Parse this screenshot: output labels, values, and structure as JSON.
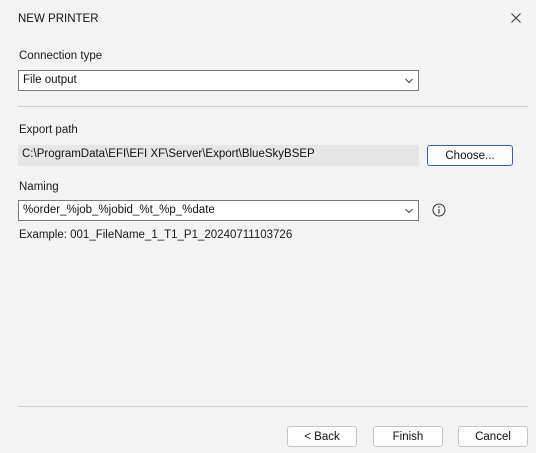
{
  "window": {
    "title": "NEW PRINTER"
  },
  "connection": {
    "label": "Connection type",
    "selected": "File output"
  },
  "export": {
    "label": "Export path",
    "path": "C:\\ProgramData\\EFI\\EFI XF\\Server\\Export\\BlueSkyBSEP",
    "choose_label": "Choose..."
  },
  "naming": {
    "label": "Naming",
    "selected": "%order_%job_%jobid_%t_%p_%date",
    "example": "Example: 001_FileName_1_T1_P1_20240711103726"
  },
  "footer": {
    "back_label": "< Back",
    "finish_label": "Finish",
    "cancel_label": "Cancel"
  },
  "icons": {
    "close": "close-icon",
    "chevron": "chevron-down-icon",
    "info": "info-icon"
  },
  "colors": {
    "accent": "#2a64c8",
    "background": "#f3f3f3"
  }
}
